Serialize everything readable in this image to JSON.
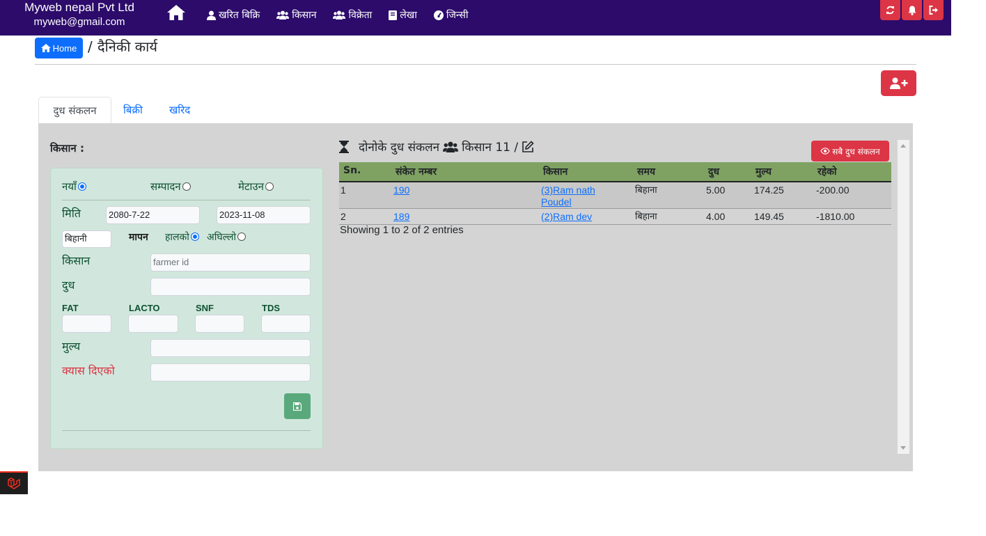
{
  "brand": {
    "name": "Myweb nepal Pvt Ltd",
    "email": "myweb@gmail.com"
  },
  "nav": [
    {
      "label": "खरित बिक्रि",
      "icon": "user-icon"
    },
    {
      "label": "किसान",
      "icon": "users-icon"
    },
    {
      "label": "विक्रेता",
      "icon": "users-icon"
    },
    {
      "label": "लेखा",
      "icon": "book-icon"
    },
    {
      "label": "जिन्सी",
      "icon": "dashboard-icon"
    }
  ],
  "top_buttons": [
    "refresh-icon",
    "bell-icon",
    "logout-icon"
  ],
  "breadcrumb": {
    "home": "Home",
    "separator": "/",
    "current": "दैनिकी कार्य"
  },
  "tabs": {
    "milk": "दुध संकलन",
    "sales": "बिक्री",
    "purchase": "खरिद"
  },
  "form": {
    "heading": "किसान :",
    "mode_new": "नयाँ",
    "mode_edit": "सम्पादन",
    "mode_delete": "मेटाउन",
    "date_label": "मिति",
    "date_bs": "2080-7-22",
    "date_ad": "2023-11-08",
    "shift": "बिहानी",
    "measure_label": "मापन",
    "measure_current": "हालको",
    "measure_previous": "अघिल्लो",
    "farmer_label": "किसान",
    "farmer_placeholder": "farmer id",
    "milk_label": "दुध",
    "fat_label": "FAT",
    "lacto_label": "LACTO",
    "snf_label": "SNF",
    "tds_label": "TDS",
    "price_label": "मुल्य",
    "cash_label": "क्यास दिएको",
    "colors": {
      "cash_label": "#dc3545",
      "card_bg": "#d1e7dd"
    }
  },
  "collection": {
    "title": "दोनोके दुध संकलन",
    "farmer_count_label": "किसान 11 /",
    "view_all": "सबै दुध संकलन",
    "headers": [
      "Sn.",
      "संकेत नम्बर",
      "किसान",
      "समय",
      "दुध",
      "मुल्य",
      "रहेको"
    ],
    "rows": [
      {
        "sn": "1",
        "code": "190",
        "farmer_line1": "(3)Ram nath",
        "farmer_line2": "Poudel",
        "time": "बिहाना",
        "milk": "5.00",
        "price": "174.25",
        "balance": "-200.00"
      },
      {
        "sn": "2",
        "code": "189",
        "farmer_line1": "(2)Ram dev",
        "farmer_line2": "",
        "time": "बिहाना",
        "milk": "4.00",
        "price": "149.45",
        "balance": "-1810.00"
      }
    ],
    "showing": "Showing 1 to 2 of 2 entries",
    "colors": {
      "header_bg": "#7fa262"
    }
  }
}
